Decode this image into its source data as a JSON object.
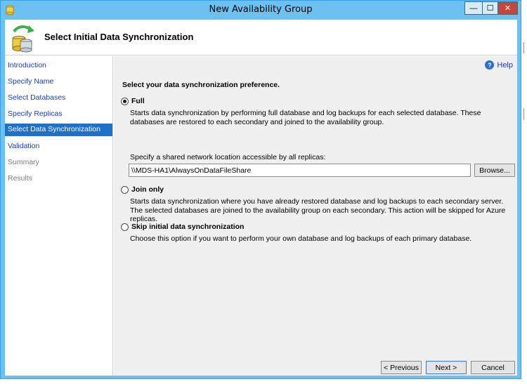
{
  "window": {
    "title": "New Availability Group",
    "minimize_label": "—",
    "maximize_label": "☐",
    "close_label": "✕"
  },
  "header": {
    "title": "Select Initial Data Synchronization"
  },
  "nav": {
    "items": [
      {
        "label": "Introduction",
        "state": "link"
      },
      {
        "label": "Specify Name",
        "state": "link"
      },
      {
        "label": "Select Databases",
        "state": "link"
      },
      {
        "label": "Specify Replicas",
        "state": "link"
      },
      {
        "label": "Select Data Synchronization",
        "state": "active"
      },
      {
        "label": "Validation",
        "state": "link"
      },
      {
        "label": "Summary",
        "state": "disabled"
      },
      {
        "label": "Results",
        "state": "disabled"
      }
    ]
  },
  "content": {
    "help_label": "Help",
    "prompt": "Select your data synchronization preference.",
    "options": [
      {
        "label": "Full",
        "selected": true,
        "description": "Starts data synchronization by performing full database and log backups for each selected database. These databases are restored to each secondary and joined to the availability group."
      },
      {
        "label": "Join only",
        "selected": false,
        "description": "Starts data synchronization where you have already restored database and log backups to each secondary server. The selected databases are joined to the availability group on each secondary. This action will be skipped for Azure replicas."
      },
      {
        "label": "Skip initial data synchronization",
        "selected": false,
        "description": "Choose this option if you want to perform your own database and log backups of each primary database."
      }
    ],
    "share_label": "Specify a shared network location accessible by all replicas:",
    "share_value": "\\\\MDS-HA1\\AlwaysOnDataFileShare",
    "browse_label": "Browse..."
  },
  "footer": {
    "previous_label": "< Previous",
    "next_label": "Next >",
    "cancel_label": "Cancel"
  },
  "colors": {
    "titlebar": "#6cc1f0",
    "nav_active": "#1e70c8",
    "link": "#1a3ea8",
    "close_button": "#c7463b"
  }
}
